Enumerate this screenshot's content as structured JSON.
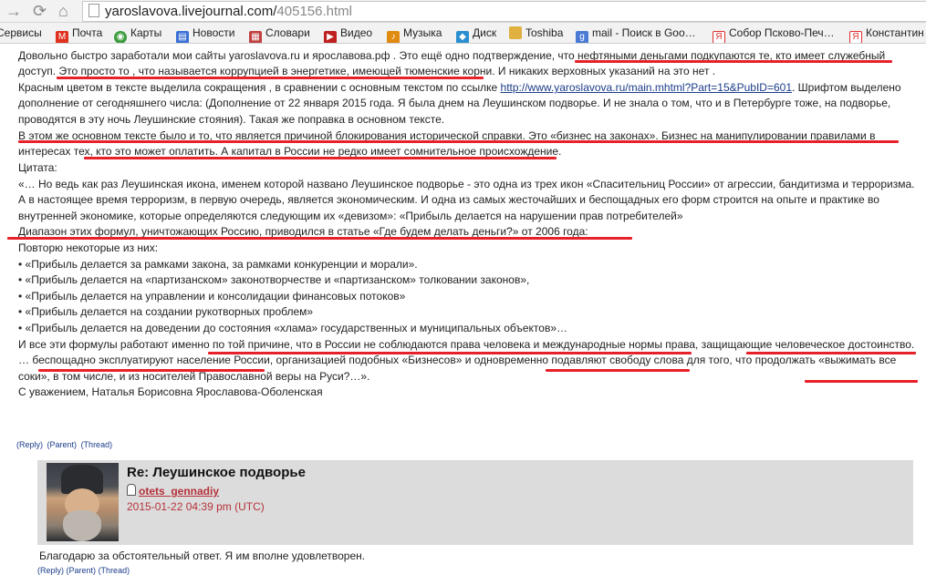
{
  "browser": {
    "url_host": "yaroslavova.livejournal.com/",
    "url_path": "405156.html",
    "bookmarks": [
      {
        "label": "Сервисы",
        "icon": "apps-icon",
        "color": "#4a7bd4"
      },
      {
        "label": "Почта",
        "icon": "mail-icon",
        "color": "#e0301e"
      },
      {
        "label": "Карты",
        "icon": "maps-icon",
        "color": "#3b9c3b"
      },
      {
        "label": "Новости",
        "icon": "news-icon",
        "color": "#3b6fd4"
      },
      {
        "label": "Словари",
        "icon": "dictionary-icon",
        "color": "#c04040"
      },
      {
        "label": "Видео",
        "icon": "video-icon",
        "color": "#c02020"
      },
      {
        "label": "Музыка",
        "icon": "music-icon",
        "color": "#e08a10"
      },
      {
        "label": "Диск",
        "icon": "disk-icon",
        "color": "#2a8fd0"
      },
      {
        "label": "Toshiba",
        "icon": "folder-icon",
        "color": "#e0b040"
      },
      {
        "label": "mail - Поиск в Goo…",
        "icon": "google-icon",
        "color": "#4a7bd4"
      },
      {
        "label": "Собор Псково-Печ…",
        "icon": "yandex-icon",
        "color": "#e03030"
      },
      {
        "label": "Константин",
        "icon": "yandex-icon",
        "color": "#e03030"
      }
    ]
  },
  "post": {
    "lines": [
      "Довольно быстро заработали мои сайты yaroslavova.ru и ярославова.рф . Это ещё одно подтверждение, что нефтяными деньгами подкупаются те, кто имеет служебный",
      "доступ. Это просто то , что называется коррупцией в энергетике, имеющей тюменские корни. И никаких верховных указаний на это нет .",
      "Красным цветом в тексте выделила сокращения , в сравнении с основным текстом по ссылке ",
      "дополнение от сегодняшнего числа: (Дополнение от 22 января 2015 года. Я была днем на Леушинском подворье. И не знала о том, что и в Петербурге тоже, на подворье,",
      "проводятся в эту ночь Леушинские стояния). Такая же поправка в основном тексте.",
      "В этом же основном тексте было и то, что является причиной блокирования исторической справки. Это «бизнес на законах». Бизнес на манипулировании правилами в",
      "интересах тех, кто это может оплатить. А капитал в России не редко имеет сомнительное происхождение.",
      "Цитата:",
      "«… Но ведь как раз Леушинская икона, именем которой названо Леушинское подворье - это одна из трех икон «Спасительниц России» от агрессии, бандитизма и терроризма.",
      "А в настоящее время терроризм, в первую очередь, является экономическим. И одна из самых жесточайших и беспощадных его форм строится на опыте и практике во",
      "внутренней экономике, которые определяются следующим их «девизом»: «Прибыль делается на нарушении прав потребителей»",
      "Диапазон этих формул, уничтожающих Россию, приводился в статье «Где будем делать деньги?» от 2006 года:",
      "Повторю некоторые из них:",
      "• «Прибыль делается за рамками закона, за рамками конкуренции и морали».",
      "• «Прибыль делается на «партизанском» законотворчестве и «партизанском» толковании законов»,",
      "• «Прибыль делается на управлении и консолидации финансовых потоков»",
      "• «Прибыль делается на создании рукотворных проблем»",
      "• «Прибыль делается на доведении до состояния «хлама» государственных и муниципальных объектов»…",
      "И все эти формулы работают именно по той причине, что в России не соблюдаются права человека и международные нормы права, защищающие человеческое достоинство.",
      "… беспощадно эксплуатируют население России, организацией подобных «Бизнесов» и одновременно подавляют свободу слова для того, что продолжать «выжимать все",
      "соки», в том числе, и из носителей Православной веры на Руси?…».",
      "С уважением, Наталья Борисовна Ярославова-Оболенская"
    ],
    "link_text": "http://www.yaroslavova.ru/main.mhtml?Part=15&PubID=601",
    "after_link": ". Шрифтом выделено"
  },
  "comment_links": {
    "reply": "(Reply)",
    "parent": "(Parent)",
    "thread": "(Thread)"
  },
  "reply": {
    "title": "Re: Леушинское подворье",
    "user": "otets_gennadiy",
    "date": "2015-01-22 04:39 pm (UTC)",
    "text": "Благодарю за обстоятельный ответ. Я им вполне удовлетворен."
  },
  "highlight_color": "#e8202a"
}
